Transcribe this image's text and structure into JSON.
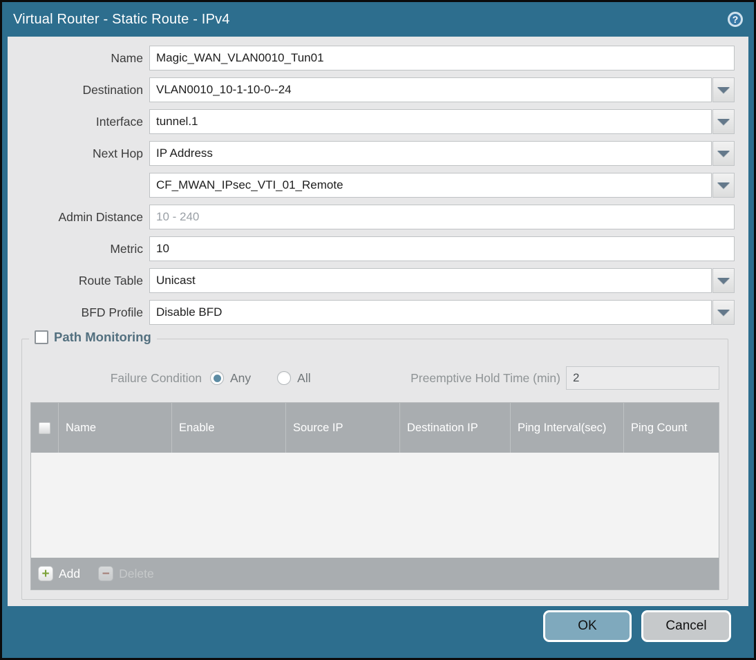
{
  "titlebar": {
    "title": "Virtual Router - Static Route - IPv4",
    "help_glyph": "?"
  },
  "form": {
    "name": {
      "label": "Name",
      "value": "Magic_WAN_VLAN0010_Tun01"
    },
    "destination": {
      "label": "Destination",
      "value": "VLAN0010_10-1-10-0--24"
    },
    "interface": {
      "label": "Interface",
      "value": "tunnel.1"
    },
    "next_hop": {
      "label": "Next Hop",
      "value": "IP Address"
    },
    "next_hop_address": {
      "value": "CF_MWAN_IPsec_VTI_01_Remote"
    },
    "admin_distance": {
      "label": "Admin Distance",
      "placeholder": "10 - 240",
      "value": ""
    },
    "metric": {
      "label": "Metric",
      "value": "10"
    },
    "route_table": {
      "label": "Route Table",
      "value": "Unicast"
    },
    "bfd_profile": {
      "label": "BFD Profile",
      "value": "Disable BFD"
    }
  },
  "path_monitoring": {
    "title": "Path Monitoring",
    "enabled": false,
    "failure_condition": {
      "label": "Failure Condition",
      "options": [
        "Any",
        "All"
      ],
      "selected": "Any"
    },
    "preemptive_hold_time": {
      "label": "Preemptive Hold Time (min)",
      "value": "2"
    },
    "table": {
      "columns": [
        "Name",
        "Enable",
        "Source IP",
        "Destination IP",
        "Ping Interval(sec)",
        "Ping Count"
      ],
      "rows": []
    },
    "actions": {
      "add": "Add",
      "delete": "Delete",
      "add_glyph": "+",
      "delete_glyph": "−"
    }
  },
  "footer": {
    "ok": "OK",
    "cancel": "Cancel"
  },
  "colors": {
    "frame_teal": "#2d6e8e",
    "content_bg": "#e7e7e8",
    "table_header_bg": "#a9adb0",
    "ok_button_bg": "#7fa9bd",
    "cancel_button_bg": "#c6c9cb",
    "add_icon_green": "#7da33a",
    "delete_icon_red": "#a05a4a",
    "radio_selected": "#5d8ca4"
  }
}
